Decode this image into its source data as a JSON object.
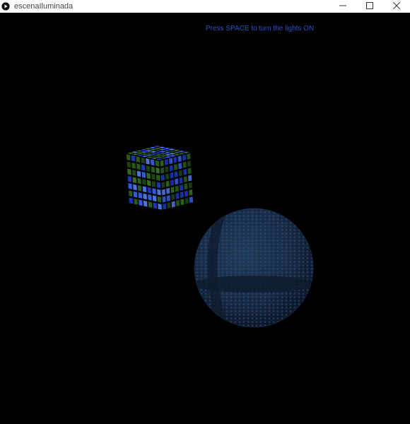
{
  "window": {
    "title": "escenaIluminada",
    "icons": {
      "app": "processing-play-icon",
      "minimize": "minimize-icon",
      "maximize": "maximize-icon",
      "close": "close-icon"
    }
  },
  "canvas": {
    "instruction": "Press SPACE to turn the lights ON",
    "instruction_color": "#2a52c9",
    "background": "#000000"
  },
  "scene": {
    "cube": {
      "colors": [
        "#1f3fd6",
        "#3a6bff",
        "#2f6b1e",
        "#3c7d2a",
        "#234f16",
        "#5b86ff"
      ]
    },
    "sphere": {
      "color": "#1a2f4a"
    }
  }
}
